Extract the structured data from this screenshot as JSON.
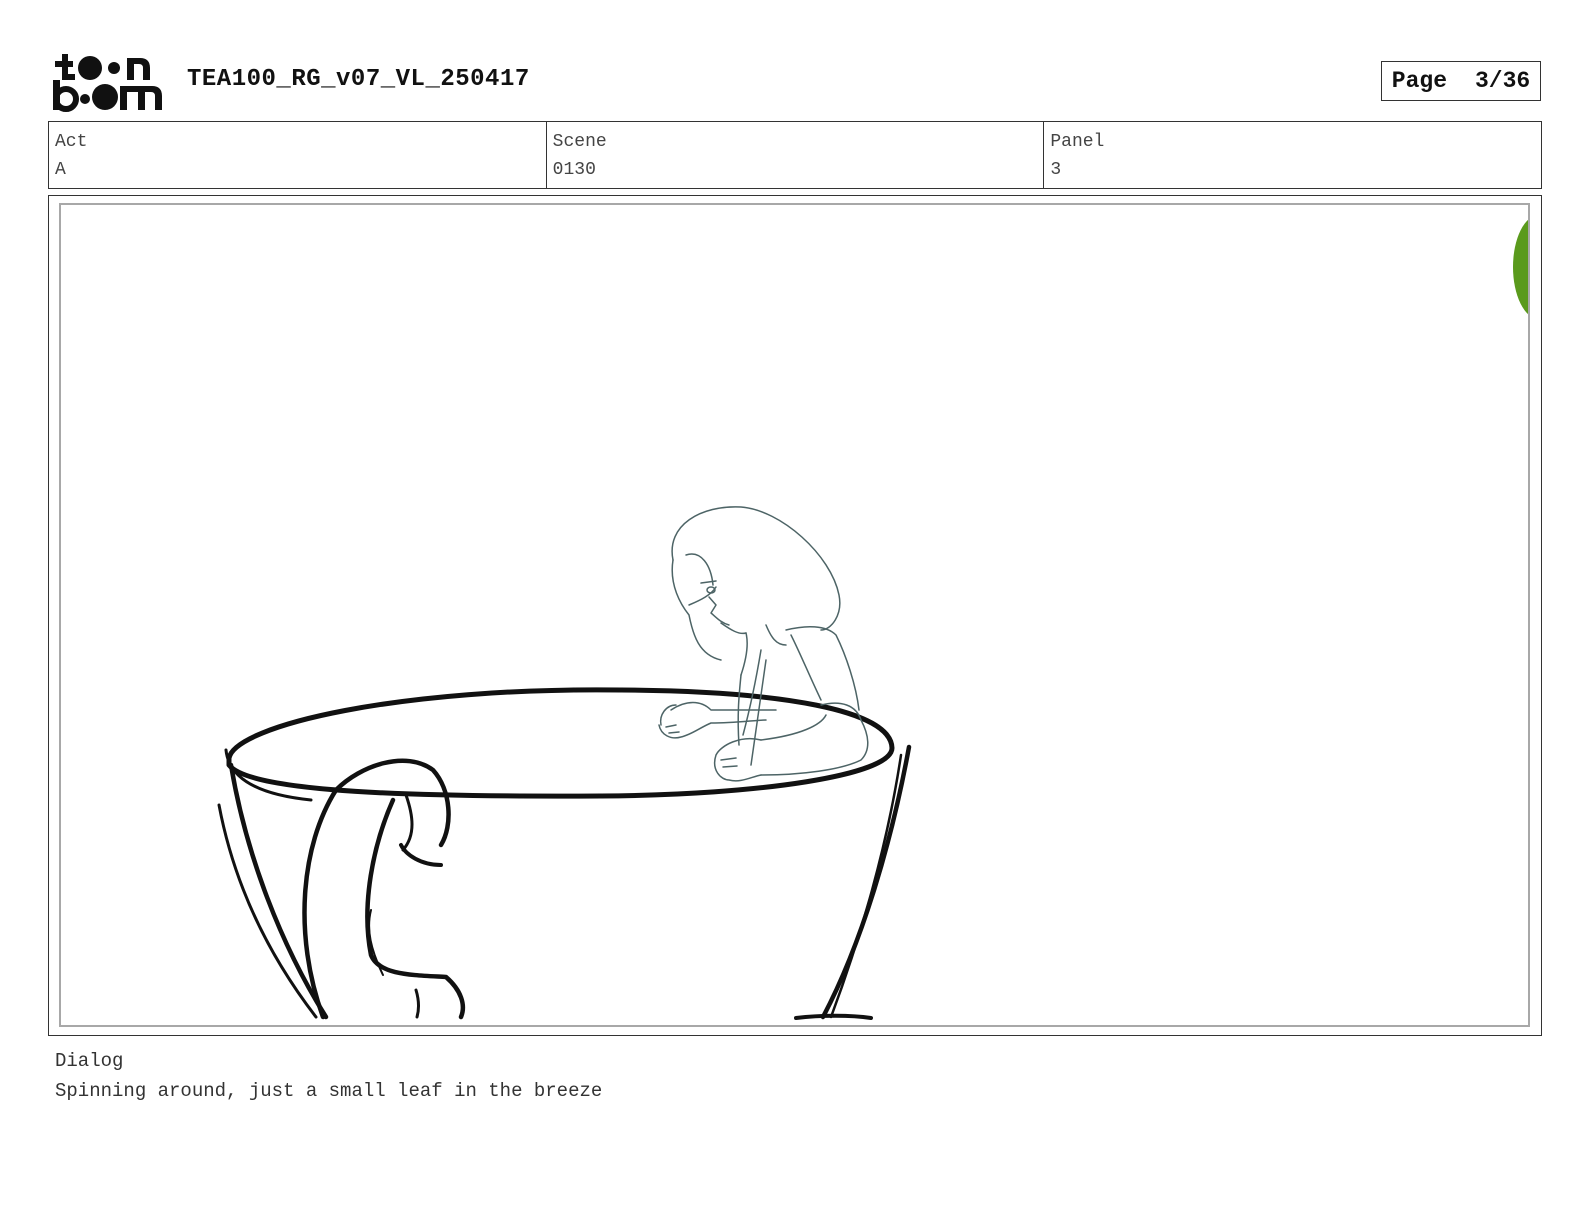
{
  "header": {
    "logo_text": "toon boom",
    "title": "TEA100_RG_v07_VL_250417",
    "page_label": "Page",
    "page_value": "3/36"
  },
  "meta": {
    "act_label": "Act",
    "act_value": "A",
    "scene_label": "Scene",
    "scene_value": "0130",
    "panel_label": "Panel",
    "panel_value": "3"
  },
  "panel": {
    "leaf_color": "#5a9a1c",
    "cup_color": "#111111",
    "figure_color": "#4d6466"
  },
  "dialog": {
    "label": "Dialog",
    "text": "Spinning around, just a small leaf in the breeze"
  }
}
